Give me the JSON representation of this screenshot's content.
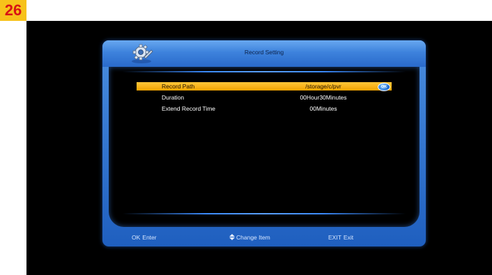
{
  "page_number": "26",
  "window": {
    "title": "Record Setting",
    "icon": "gear-wrench-icon"
  },
  "settings": [
    {
      "label": "Record Path",
      "value": "/storage/c/pvr",
      "selected": true,
      "badge": "OK"
    },
    {
      "label": "Duration",
      "value": "00Hour30Minutes",
      "selected": false
    },
    {
      "label": "Extend Record Time",
      "value": "00Minutes",
      "selected": false
    }
  ],
  "help_bar": {
    "enter_key": "OK",
    "enter_label": "Enter",
    "change_icon": "up-down-arrow-icon",
    "change_label": "Change Item",
    "exit_key": "EXIT",
    "exit_label": "Exit"
  },
  "colors": {
    "accent_blue": "#3d82dc",
    "highlight": "#f3a300",
    "page_badge": "#f7c21a",
    "page_number_text": "#d81414"
  }
}
